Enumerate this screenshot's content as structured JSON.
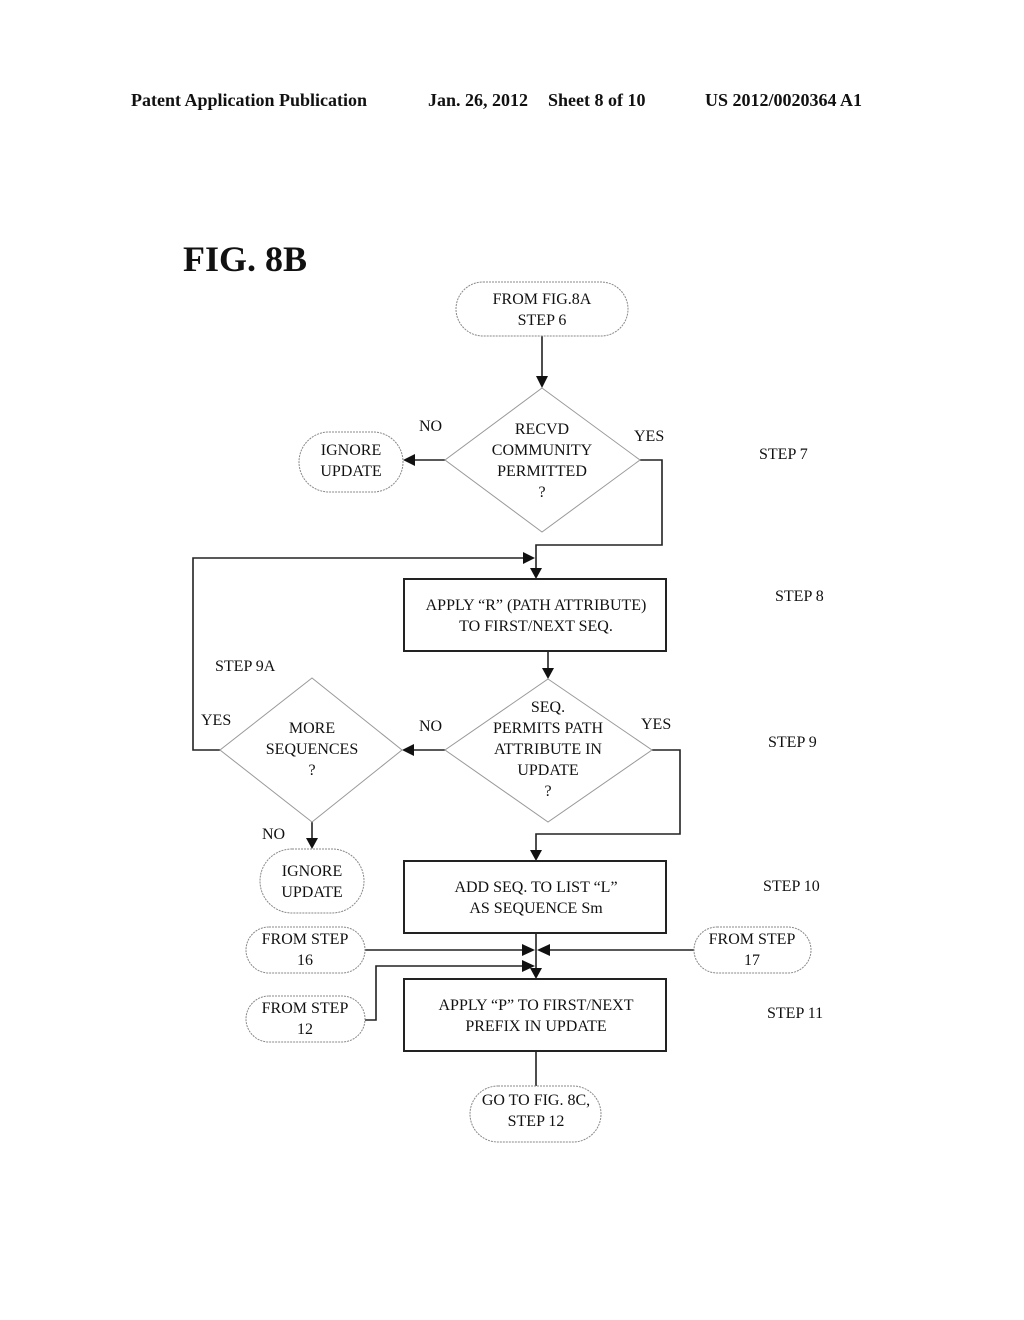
{
  "header": {
    "publication": "Patent Application Publication",
    "date": "Jan. 26, 2012",
    "sheet": "Sheet 8 of 10",
    "number": "US 2012/0020364 A1"
  },
  "figure_label": "FIG. 8B",
  "nodes": {
    "start": [
      "FROM FIG.8A",
      "STEP 6"
    ],
    "decision_community": [
      "RECVD",
      "COMMUNITY",
      "PERMITTED",
      "?"
    ],
    "ignore_update_1": [
      "IGNORE",
      "UPDATE"
    ],
    "apply_r": [
      "APPLY “R” (PATH ATTRIBUTE)",
      "TO FIRST/NEXT SEQ."
    ],
    "decision_seq": [
      "SEQ.",
      "PERMITS PATH",
      "ATTRIBUTE IN",
      "UPDATE",
      "?"
    ],
    "decision_more": [
      "MORE",
      "SEQUENCES",
      "?"
    ],
    "ignore_update_2": [
      "IGNORE",
      "UPDATE"
    ],
    "add_seq": [
      "ADD SEQ. TO LIST “L”",
      "AS SEQUENCE Sm"
    ],
    "from_step_16": [
      "FROM STEP",
      "16"
    ],
    "from_step_17": [
      "FROM STEP",
      "17"
    ],
    "from_step_12": [
      "FROM STEP",
      "12"
    ],
    "apply_p": [
      "APPLY “P” TO FIRST/NEXT",
      "PREFIX IN UPDATE"
    ],
    "goto_8c": [
      "GO TO FIG. 8C,",
      "STEP 12"
    ]
  },
  "edge_labels": {
    "community_no": "NO",
    "community_yes": "YES",
    "seq_no": "NO",
    "seq_yes": "YES",
    "more_yes": "YES",
    "more_no": "NO"
  },
  "step_labels": {
    "step7": "STEP 7",
    "step8": "STEP 8",
    "step9a": "STEP 9A",
    "step9": "STEP 9",
    "step10": "STEP 10",
    "step11": "STEP 11"
  }
}
